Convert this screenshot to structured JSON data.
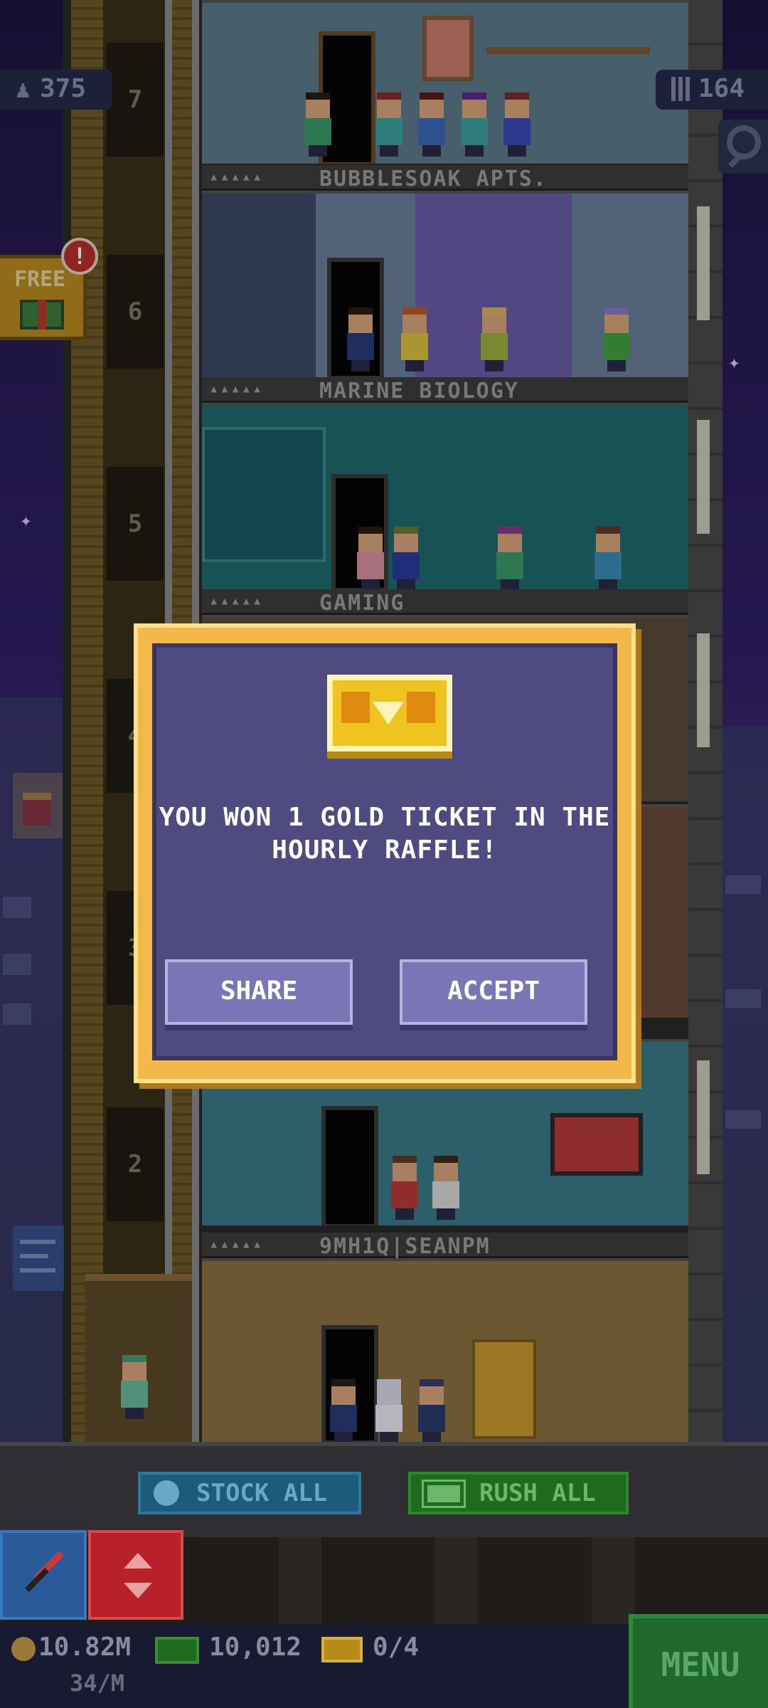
{
  "hud": {
    "population": "375",
    "floors": "164",
    "free_label": "FREE",
    "notification_count": "!"
  },
  "elevator": {
    "floor_numbers": [
      "7",
      "6",
      "5",
      "4",
      "3",
      "2"
    ]
  },
  "floors": {
    "f1": "BUBBLESOAK APTS.",
    "f2": "MARINE BIOLOGY",
    "f3": "GAMING",
    "f4": "9MH1Q|SEANPM",
    "dots": "▴▴▴▴▴"
  },
  "dialog": {
    "message": "YOU WON 1 GOLD TICKET IN THE HOURLY RAFFLE!",
    "share_label": "SHARE",
    "accept_label": "ACCEPT"
  },
  "actions": {
    "stock_all_label": "STOCK ALL",
    "rush_all_label": "RUSH ALL"
  },
  "status": {
    "coins": "10.82M",
    "coins_rate": "34/M",
    "bux": "10,012",
    "tickets": "0/4",
    "menu_label": "MENU"
  },
  "colors": {
    "dialog_border": "#f2b84a",
    "dialog_fill": "#4f4a80",
    "button_fill": "#7a75b5",
    "menu_green": "#1f6a2a",
    "elevator_red": "#b8202a"
  },
  "icons": [
    "population-icon",
    "floors-icon",
    "search-icon",
    "gift-icon",
    "gold-ticket-icon",
    "clock-icon",
    "cash-icon",
    "hammer-icon",
    "elevator-arrows-icon",
    "coin-icon",
    "bux-icon",
    "ticket-icon"
  ]
}
